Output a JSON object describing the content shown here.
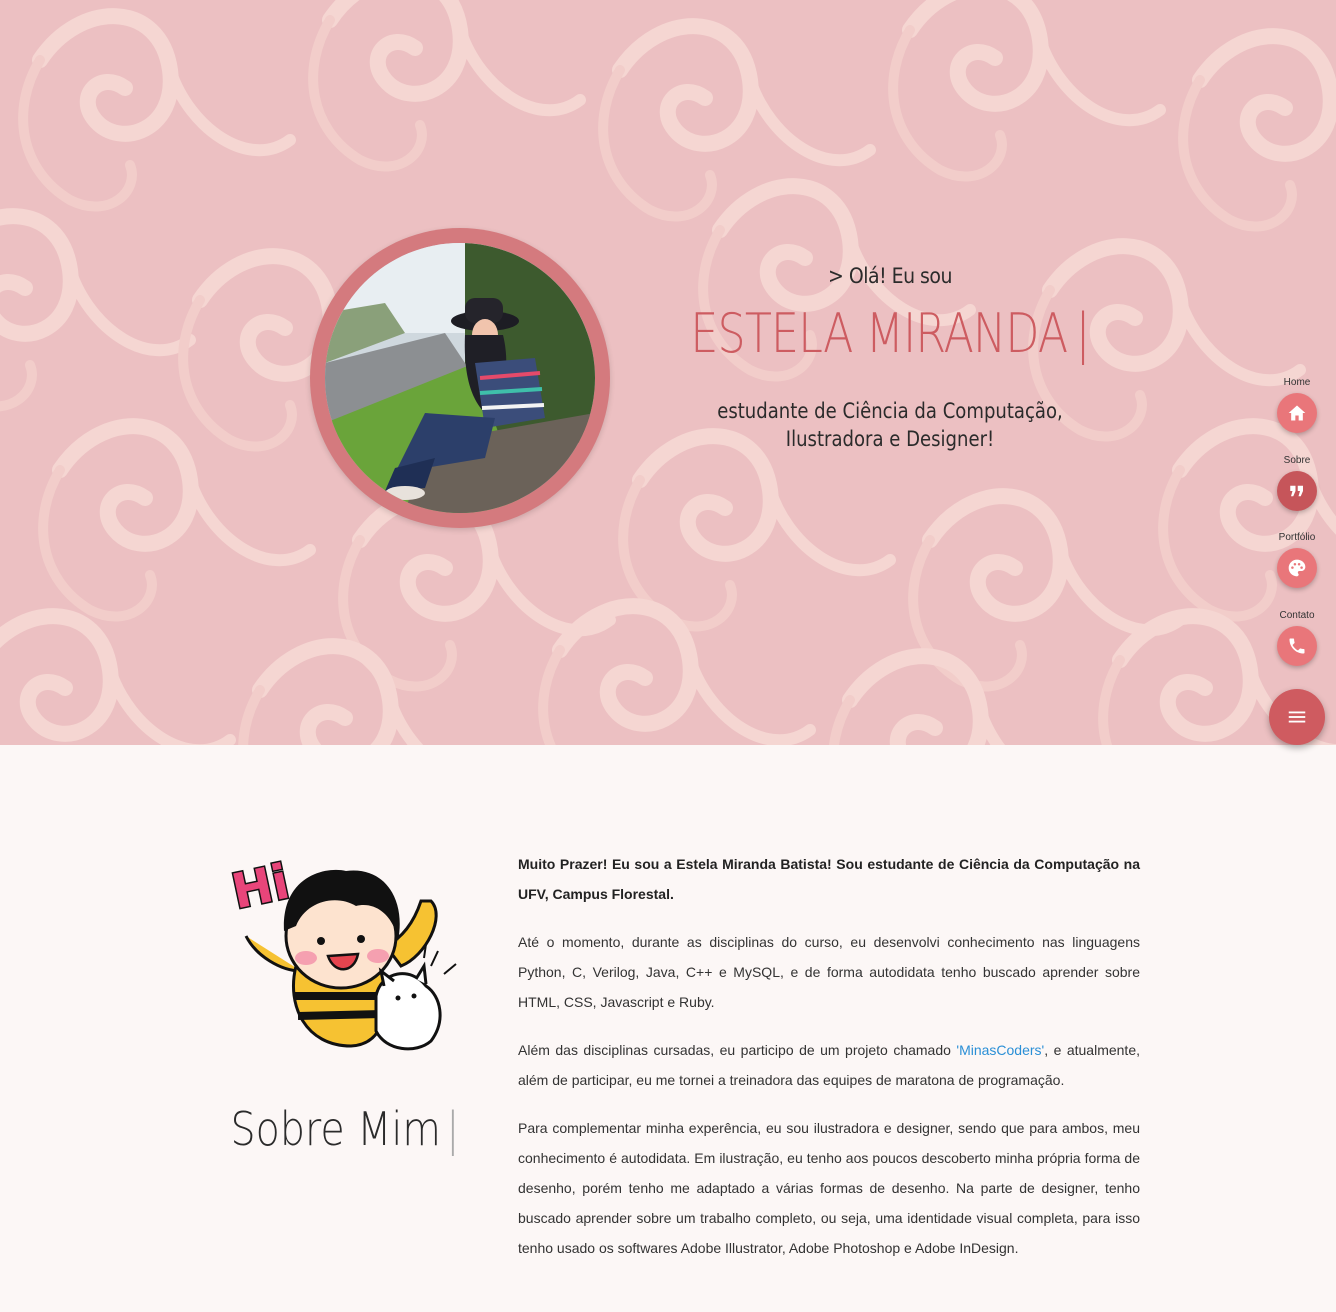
{
  "hero": {
    "greeting": "> Olá! Eu sou",
    "name": "ESTELA MIRANDA",
    "cursor": "|",
    "subtitle_line1": "estudante de Ciência da Computação,",
    "subtitle_line2": "Ilustradora e Designer!",
    "photo_alt": "photo-of-estela"
  },
  "nav": {
    "items": [
      {
        "label": "Home",
        "icon": "home-icon"
      },
      {
        "label": "Sobre",
        "icon": "quote-icon"
      },
      {
        "label": "Portfólio",
        "icon": "palette-icon"
      },
      {
        "label": "Contato",
        "icon": "phone-icon"
      }
    ],
    "menu_icon": "menu-icon"
  },
  "about": {
    "title": "Sobre Mim",
    "cursor": "|",
    "mascot_text": "Hi",
    "p1": "Muito Prazer! Eu sou a Estela Miranda Batista! Sou estudante de Ciência da Computação na UFV, Campus Florestal.",
    "p2": "Até o momento, durante as disciplinas do curso, eu desenvolvi conhecimento nas linguagens Python, C, Verilog, Java, C++ e MySQL, e de forma autodidata tenho buscado aprender sobre HTML, CSS, Javascript e Ruby.",
    "p3_before": "Além das disciplinas cursadas, eu participo de um projeto chamado ",
    "p3_link": "'MinasCoders'",
    "p3_after": ", e atualmente, além de participar, eu me tornei a treinadora das equipes de maratona de programação.",
    "p4": "Para complementar minha experência, eu sou ilustradora e designer, sendo que para ambos, meu conhecimento é autodidata. Em ilustração, eu tenho aos poucos descoberto minha própria forma de desenho, porém tenho me adaptado a várias formas de desenho. Na parte de designer, tenho buscado aprender sobre um trabalho completo, ou seja, uma identidade visual completa, para isso tenho usado os softwares Adobe Illustrator, Adobe Photoshop e Adobe InDesign."
  },
  "colors": {
    "accent": "#cd5c61",
    "fab": "#e9767a",
    "hero_bg": "#ecc0c2",
    "link": "#2a8fd6"
  }
}
